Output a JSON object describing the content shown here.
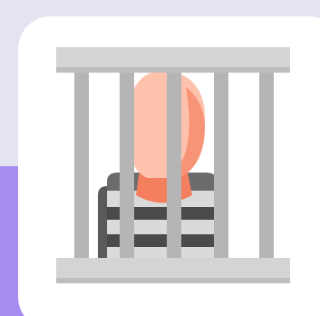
{
  "colors": {
    "background_top": "#E4E3F0",
    "background_bottom": "#A58CF0",
    "card": "#FFFFFF",
    "cage_bar": "#B8B8B8",
    "cage_rail": "#D4D4D4",
    "head": "#FDC2AC",
    "head_shade": "#F79478",
    "neck": "#F47F5E",
    "shirt_dark": "#4A4A4A",
    "shirt_light": "#D9D9D9"
  },
  "icon": {
    "name": "prisoner-behind-bars-icon"
  }
}
